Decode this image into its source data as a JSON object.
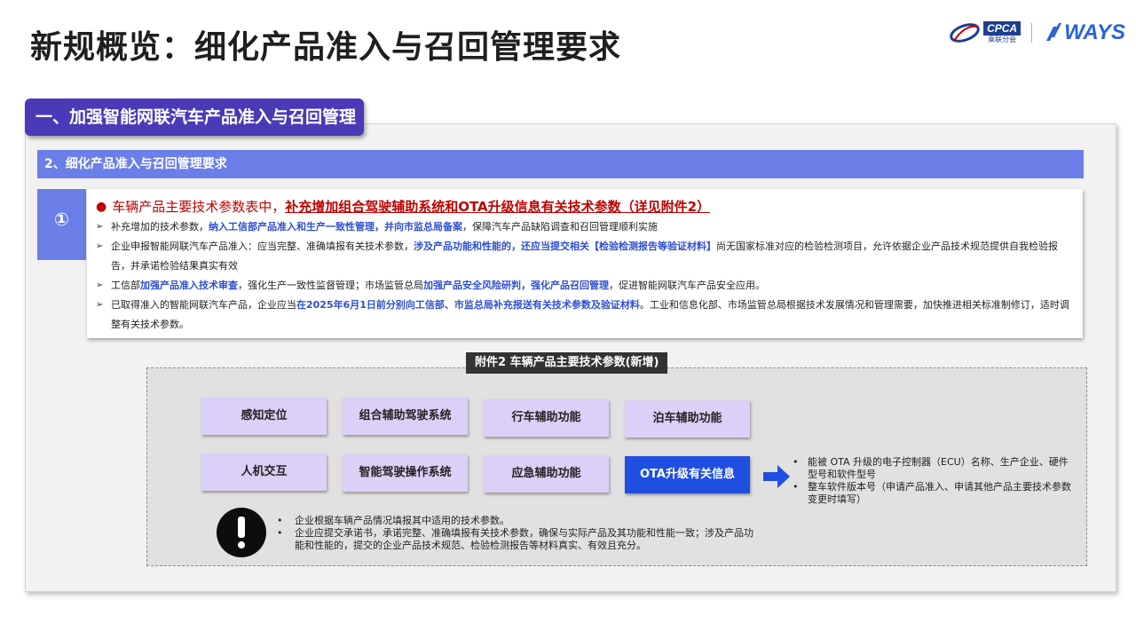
{
  "title": "新规概览：细化产品准入与召回管理要求",
  "logos": {
    "cpca_text": "CPCA",
    "cpca_sub": "乘联分会",
    "ways_text": "WAYS"
  },
  "section_tab": "一、加强智能网联汽车产品准入与召回管理",
  "sub_header": "2、细化产品准入与召回管理要求",
  "number_badge": "①",
  "headline": {
    "dot": "●",
    "prefix": "车辆产品主要技术参数表中，",
    "emphasis": "补充增加组合驾驶辅助系统和OTA升级信息有关技术参数（详见附件2）"
  },
  "bullet_glyph": "➢",
  "bullets": [
    {
      "t1": "补充增加的技术参数，",
      "b1": "纳入工信部产品准入和生产一致性管理，并向市监总局备案",
      "t2": "，保障汽车产品缺陷调查和召回管理顺利实施",
      "b2": "",
      "t3": ""
    },
    {
      "t1": "企业申报智能网联汽车产品准入：应当完整、准确填报有关技术参数，",
      "b1": "涉及产品功能和性能的，还应当提交相关【检验检测报告等验证材料】",
      "t2": "尚无国家标准对应的检验检测项目，允许依据企业产品技术规范提供自我检验报告，并承诺检验结果真实有效",
      "b2": "",
      "t3": ""
    },
    {
      "t1": "工信部",
      "b1": "加强产品准入技术审查",
      "t2": "，强化生产一致性监督管理；市场监管总局",
      "b2": "加强产品安全风险研判，强化产品召回管理",
      "t3": "，促进智能网联汽车产品安全应用。"
    },
    {
      "t1": "已取得准入的智能网联汽车产品，企业应当",
      "b1": "在2025年6月1日前分别向工信部、市监总局补充报送有关技术参数及验证材料",
      "t2": "。工业和信息化部、市场监管总局根据技术发展情况和管理需要，加快推进相关标准制修订，适时调整有关技术参数。",
      "b2": "",
      "t3": ""
    }
  ],
  "annex_label": "附件2 车辆产品主要技术参数(新增)",
  "params": [
    "感知定位",
    "组合辅助驾驶系统",
    "行车辅助功能",
    "泊车辅助功能",
    "人机交互",
    "智能驾驶操作系统",
    "应急辅助功能",
    "OTA升级有关信息"
  ],
  "ota_items": [
    "能被 OTA 升级的电子控制器（ECU）名称、生产企业、硬件型号和软件型号",
    "整车软件版本号（申请产品准入、申请其他产品主要技术参数变更时填写）"
  ],
  "notes": [
    "企业根据车辆产品情况填报其中适用的技术参数。",
    "企业应提交承诺书，承诺完整、准确填报有关技术参数，确保与实际产品及其功能和性能一致；涉及产品功能和性能的，提交的企业产品技术规范、检验检测报告等材料真实、有效且充分。"
  ],
  "small_bullet": "•",
  "colors": {
    "section_tab": "#4a3ab8",
    "sub_header": "#6a7fe8",
    "param_box": "#dcd0f8",
    "ota_box": "#1f4fe0",
    "emphasis_red": "#c00000",
    "emphasis_blue": "#2f4fd1"
  }
}
